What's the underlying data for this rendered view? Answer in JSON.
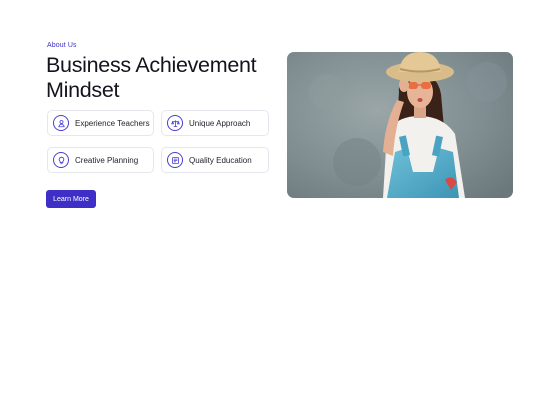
{
  "about": {
    "eyebrow": "About Us",
    "title": "Business Achievement Mindset",
    "features": [
      {
        "label": "Experience Teachers",
        "icon": "user-icon"
      },
      {
        "label": "Unique Approach",
        "icon": "scale-icon"
      },
      {
        "label": "Creative Planning",
        "icon": "lightbulb-icon"
      },
      {
        "label": "Quality Education",
        "icon": "newspaper-icon"
      }
    ],
    "cta_label": "Learn More"
  },
  "colors": {
    "accent": "#3f2fc7",
    "text": "#14141f",
    "border": "#e6e6ee"
  }
}
